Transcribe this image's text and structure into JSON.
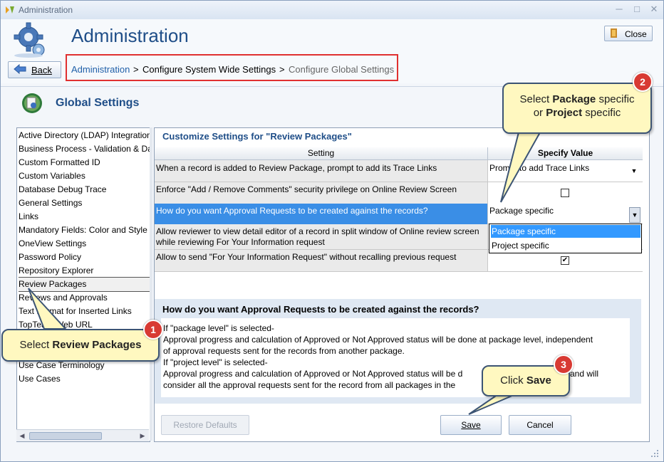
{
  "window": {
    "title": "Administration",
    "min_icon": "minimize-icon",
    "max_icon": "maximize-icon",
    "close_icon": "close-icon"
  },
  "header": {
    "title": "Administration",
    "back_label": "Back",
    "close_label": "Close",
    "breadcrumb": {
      "link": "Administration",
      "sep1": ">",
      "middle": "Configure System Wide Settings",
      "sep2": ">",
      "current": "Configure Global Settings"
    }
  },
  "section": {
    "title": "Global Settings"
  },
  "sidebar": {
    "items": [
      "Active Directory (LDAP) Integration",
      "Business Process - Validation & Data Integrity",
      "Custom Formatted ID",
      "Custom Variables",
      "Database Debug Trace",
      "General Settings",
      "Links",
      "Mandatory Fields: Color and Style",
      "OneView Settings",
      "Password Policy",
      "Repository Explorer",
      "Review Packages",
      "Reviews and Approvals",
      "Text Format for Inserted Links",
      "TopTeam Web URL",
      "",
      "Use Case Terminology",
      "Use Cases"
    ],
    "selected": "Review Packages"
  },
  "panel": {
    "title": "Customize Settings for \"Review Packages\"",
    "col_setting": "Setting",
    "col_value": "Specify Value",
    "rows": [
      {
        "setting": "When a record is added to Review Package, prompt to add its Trace Links",
        "value": "Prompt to add Trace Links"
      },
      {
        "setting": "Enforce \"Add / Remove Comments\" security privilege on Online Review Screen",
        "value": ""
      },
      {
        "setting": "How do you want Approval Requests to be created against the records?",
        "value": "Package specific"
      },
      {
        "setting": "Allow reviewer to view detail editor of a record in split window of Online review screen",
        "setting2": "while reviewing For Your Information request",
        "value": ""
      },
      {
        "setting": "Allow to send \"For Your Information Request\" without recalling previous request",
        "value": ""
      }
    ],
    "dropdown_options": [
      "Package specific",
      "Project specific"
    ],
    "dropdown_selected": "Package specific",
    "checkbox_enforce": false,
    "checkbox_fyi": true
  },
  "description": {
    "title": "How do you want Approval Requests to be created against the records?",
    "lines": [
      "If \"package level\" is selected-",
      "Approval progress and calculation of Approved or Not Approved status will be done at package level, independent",
      "of approval requests sent for the records from another package.",
      "If \"project level\" is selected-",
      "Approval progress and calculation of Approved or Not Approved status will be d",
      "consider all the approval requests sent for the record from all packages in the"
    ],
    "line5_tail": "and will"
  },
  "buttons": {
    "restore": "Restore Defaults",
    "save": "Save",
    "cancel": "Cancel"
  },
  "callouts": {
    "c1": {
      "number": "1",
      "prefix": "Select ",
      "bold": "Review Packages"
    },
    "c2": {
      "number": "2",
      "line1_prefix": "Select ",
      "line1_bold": "Package",
      "line1_suffix": " specific",
      "line2_prefix": "or ",
      "line2_bold": "Project",
      "line2_suffix": " specific"
    },
    "c3": {
      "number": "3",
      "prefix": "Click ",
      "bold": "Save"
    }
  },
  "colors": {
    "accent": "#1f4e88",
    "highlight": "#3a8ee6",
    "callout_bg": "#fff8c0",
    "badge": "#d83a33",
    "breadcrumb_box": "#e03030"
  }
}
